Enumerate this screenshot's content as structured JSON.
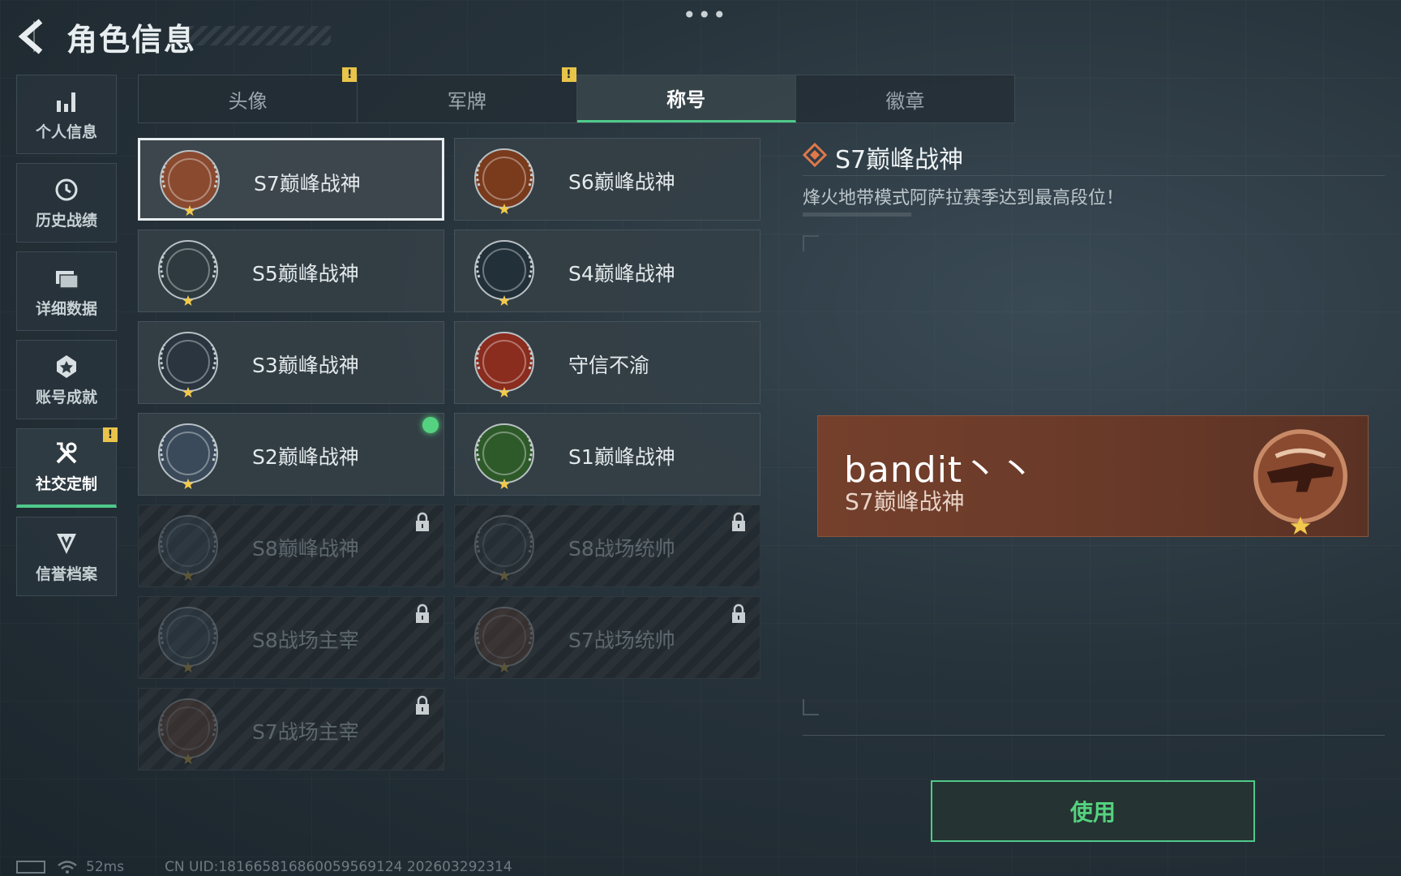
{
  "header": {
    "title": "角色信息",
    "more": "•••"
  },
  "side_nav": [
    {
      "label": "个人信息",
      "icon": "bar-chart-icon"
    },
    {
      "label": "历史战绩",
      "icon": "history-icon"
    },
    {
      "label": "详细数据",
      "icon": "folder-icon"
    },
    {
      "label": "账号成就",
      "icon": "achievement-icon"
    },
    {
      "label": "社交定制",
      "icon": "tools-icon",
      "active": true,
      "badge": "!"
    },
    {
      "label": "信誉档案",
      "icon": "shield-icon"
    }
  ],
  "tabs": [
    {
      "label": "头像",
      "badge": "!"
    },
    {
      "label": "军牌",
      "badge": "!"
    },
    {
      "label": "称号",
      "active": true
    },
    {
      "label": "徽章"
    }
  ],
  "titles": [
    {
      "name": "S7巅峰战神",
      "selected": true,
      "locked": false,
      "color": "#8a4a30"
    },
    {
      "name": "S6巅峰战神",
      "locked": false,
      "color": "#7a3a1c"
    },
    {
      "name": "S5巅峰战神",
      "locked": false,
      "color": "#2e3a40"
    },
    {
      "name": "S4巅峰战神",
      "locked": false,
      "color": "#22303a"
    },
    {
      "name": "S3巅峰战神",
      "locked": false,
      "color": "#2a3540"
    },
    {
      "name": "守信不渝",
      "locked": false,
      "color": "#8a2c1e"
    },
    {
      "name": "S2巅峰战神",
      "locked": false,
      "equipped": true,
      "color": "#3a4a5a"
    },
    {
      "name": "S1巅峰战神",
      "locked": false,
      "color": "#2e5a2a"
    },
    {
      "name": "S8巅峰战神",
      "locked": true,
      "color": "#3a4a5a"
    },
    {
      "name": "S8战场统帅",
      "locked": true,
      "color": "#2e3a40"
    },
    {
      "name": "S8战场主宰",
      "locked": true,
      "color": "#3a4a5a"
    },
    {
      "name": "S7战场统帅",
      "locked": true,
      "color": "#6a4030"
    },
    {
      "name": "S7战场主宰",
      "locked": true,
      "color": "#6a4030"
    }
  ],
  "detail": {
    "title": "S7巅峰战神",
    "description": "烽火地带模式阿萨拉赛季达到最高段位！"
  },
  "preview": {
    "player_name": "bandit丶丶",
    "title": "S7巅峰战神"
  },
  "use_button": "使用",
  "status_bar": {
    "ping": "52ms",
    "uid": "CN UID:181665816860059569124 202603292314"
  },
  "colors": {
    "accent": "#4fc98a",
    "warning": "#e8c44a",
    "preview_bg": "#74402c"
  }
}
